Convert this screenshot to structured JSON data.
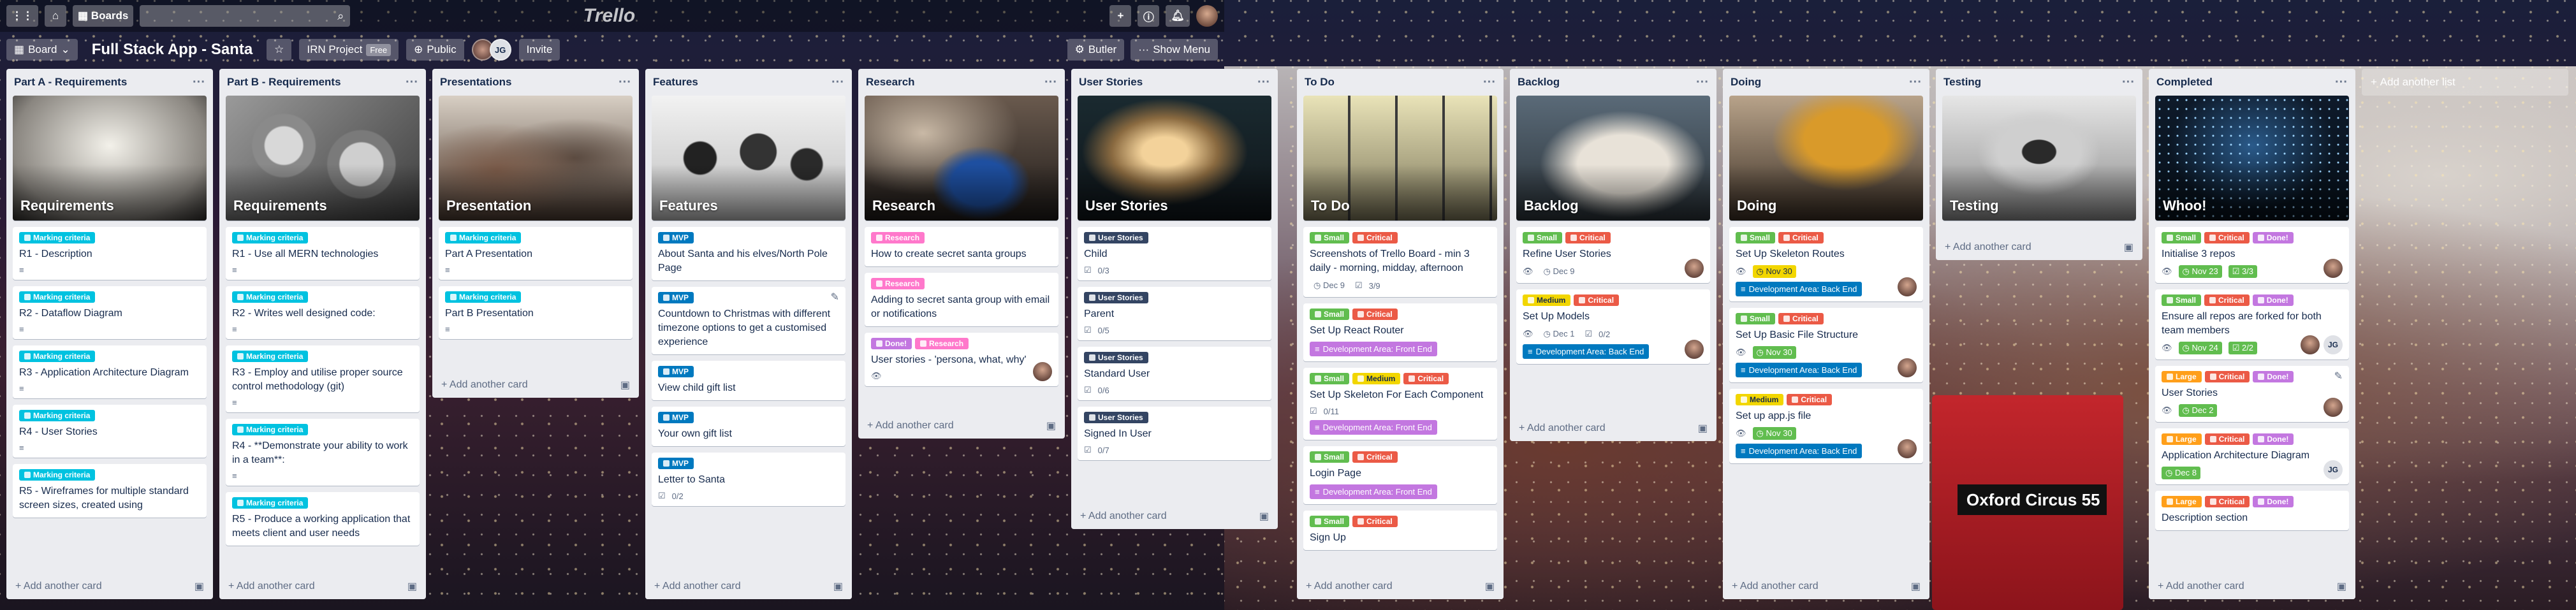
{
  "topbar": {
    "home_icon": "home-icon",
    "boards_label": "Boards",
    "logo": "Trello"
  },
  "boardbar": {
    "board_btn": "Board",
    "title": "Full Stack App - Santa",
    "workspace": "IRN Project",
    "free": "Free",
    "visibility": "Public",
    "invite": "Invite",
    "butler": "Butler",
    "show_menu": "Show Menu",
    "member_initials": "JG"
  },
  "add_card": "Add another card",
  "add_list": "Add another list",
  "labels": {
    "mc": "Marking criteria",
    "mvp": "MVP",
    "research": "Research",
    "done": "Done!",
    "small": "Small",
    "critical": "Critical",
    "medium": "Medium",
    "large": "Large",
    "us": "User Stories",
    "fe": "Development Area: Front End",
    "be": "Development Area: Back End"
  },
  "colors": {
    "mc": "#00c2e0",
    "mvp": "#0079bf",
    "research": "#ff78cb",
    "done": "#c377e0",
    "small": "#61bd4f",
    "critical": "#eb5a46",
    "medium": "#f2d600",
    "large": "#ff9f1a",
    "us": "#344563",
    "fe": "#c377e0",
    "be": "#0079bf"
  },
  "lists": {
    "partA": {
      "title": "Part A - Requirements",
      "cover": "Requirements",
      "cards": [
        "R1 - Description",
        "R2 - Dataflow Diagram",
        "R3 - Application Architecture Diagram",
        "R4 - User Stories",
        "R5 - Wireframes for multiple standard screen sizes, created using"
      ]
    },
    "partB": {
      "title": "Part B - Requirements",
      "cover": "Requirements",
      "cards": [
        "R1 - Use all MERN technologies",
        "R2 - Writes well designed code:",
        "R3 - Employ and utilise proper source control methodology (git)",
        "R4 - **Demonstrate your ability to work in a team**:",
        "R5 - Produce a working application that meets client and user needs"
      ]
    },
    "presentations": {
      "title": "Presentations",
      "cover": "Presentation",
      "cards": [
        "Part A Presentation",
        "Part B Presentation"
      ]
    },
    "features": {
      "title": "Features",
      "cover": "Features",
      "cards": [
        "About Santa and his elves/North Pole Page",
        "Countdown to Christmas with different timezone options to get a customised experience",
        "View child gift list",
        "Your own gift list",
        "Letter to Santa"
      ],
      "checklist": "0/2"
    },
    "research": {
      "title": "Research",
      "cover": "Research",
      "cards": [
        "How to create secret santa groups",
        "Adding to secret santa group with email or notifications",
        "User stories - 'persona, what, why'"
      ]
    },
    "userstories": {
      "title": "User Stories",
      "cover": "User Stories",
      "cards": [
        "Child",
        "Parent",
        "Standard User",
        "Signed In User"
      ],
      "checks": [
        "0/3",
        "0/5",
        "0/6",
        "0/7"
      ]
    },
    "todo": {
      "title": "To Do",
      "cover": "To Do",
      "cards": [
        "Screenshots of Trello Board - min 3 daily - morning, midday, afternoon",
        "Set Up React Router",
        "Set Up Skeleton For Each Component",
        "Login Page",
        "Sign Up"
      ],
      "due1": "Dec 9",
      "check1": "3/9",
      "check3": "0/11"
    },
    "backlog": {
      "title": "Backlog",
      "cover": "Backlog",
      "cards": [
        "Refine User Stories",
        "Set Up Models"
      ],
      "due1": "Dec 9",
      "due2": "Dec 1",
      "check2": "0/2"
    },
    "doing": {
      "title": "Doing",
      "cover": "Doing",
      "cards": [
        "Set Up Skeleton Routes",
        "Set Up Basic File Structure",
        "Set up app.js file"
      ],
      "due1": "Nov 30",
      "due2": "Nov 30",
      "due3": "Nov 30"
    },
    "testing": {
      "title": "Testing",
      "cover": "Testing"
    },
    "completed": {
      "title": "Completed",
      "cover": "Whoo!",
      "cards": [
        "Initialise 3 repos",
        "Ensure all repos are forked for both team members",
        "User Stories",
        "Application Architecture Diagram",
        "Description section"
      ],
      "due1": "Nov 23",
      "check1": "3/3",
      "due2": "Nov 24",
      "check2": "2/2",
      "due3": "Dec 2",
      "due4": "Dec 8"
    }
  }
}
